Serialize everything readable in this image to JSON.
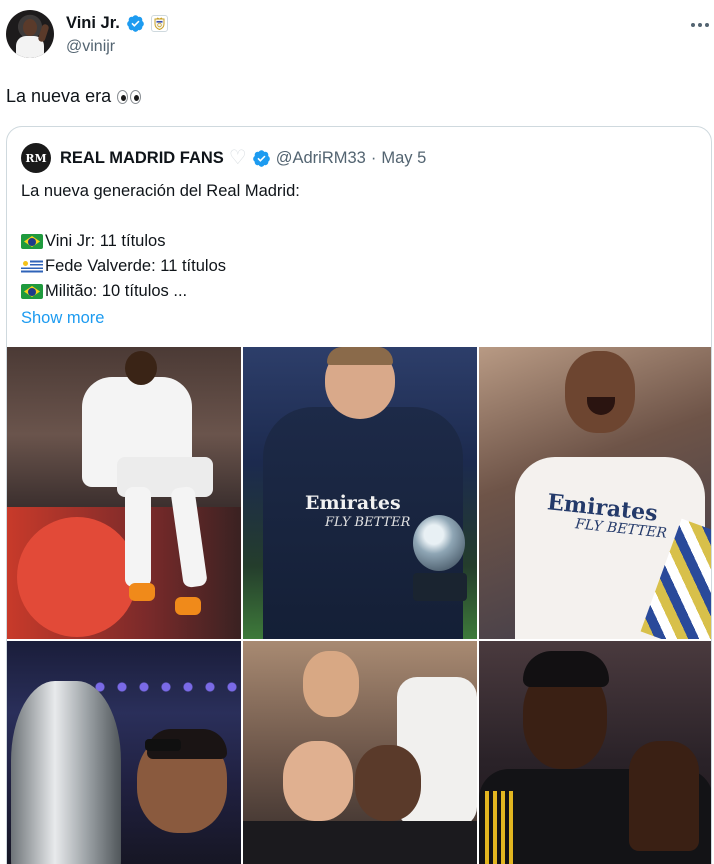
{
  "tweet": {
    "author": {
      "display_name": "Vini Jr.",
      "handle": "@vinijr",
      "verified": true,
      "badge_icon": "real-madrid-crest-icon"
    },
    "text": "La nueva era",
    "emoji": "eyes-emoji",
    "more_icon": "more-horizontal-icon"
  },
  "quote": {
    "author": {
      "avatar_text": "RM",
      "display_name": "REAL MADRID FANS",
      "name_emoji": "♡",
      "verified": true,
      "handle": "@AdriRM33",
      "separator": "·",
      "date": "May 5"
    },
    "lines": [
      {
        "text": "La nueva generación del Real Madrid:"
      },
      {
        "flag": "",
        "text": ""
      },
      {
        "flag": "brazil-flag",
        "text": "Vini Jr: 11 títulos"
      },
      {
        "flag": "uruguay-flag",
        "text": "Fede Valverde: 11 títulos"
      },
      {
        "flag": "brazil-flag",
        "text": "Militão: 10 títulos ..."
      }
    ],
    "show_more": "Show more",
    "media": {
      "tile_2_sponsor": "Emirates",
      "tile_2_sponsor_sub": "FLY BETTER",
      "tile_3_sponsor": "Emirates",
      "tile_3_sponsor_sub": "FLY BETTER"
    }
  },
  "colors": {
    "link": "#1d9bf0",
    "verified": "#1d9bf0",
    "muted": "#536471",
    "border": "#cfd9de"
  }
}
